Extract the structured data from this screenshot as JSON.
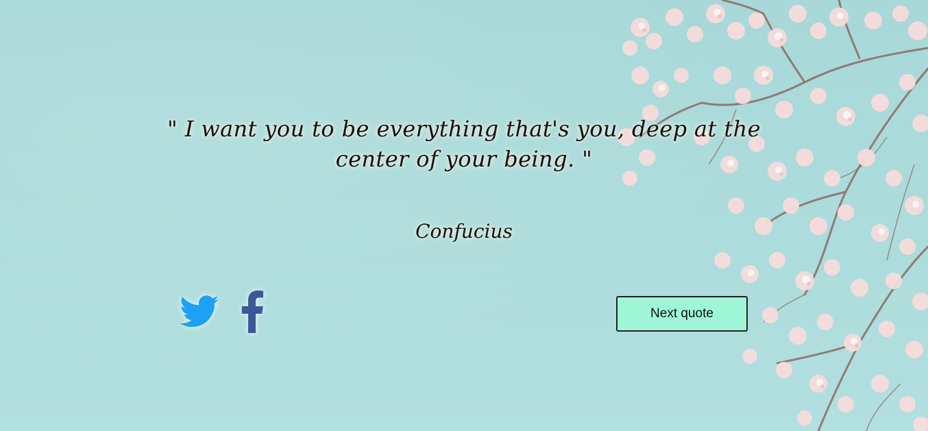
{
  "quote": {
    "text": "\" I want you to be everything that's you, deep at the center of your being. \"",
    "author": "Confucius"
  },
  "social": {
    "twitter_icon": "twitter-icon",
    "facebook_icon": "facebook-icon",
    "twitter_color": "#1da1f2",
    "facebook_color": "#3b5998"
  },
  "actions": {
    "next_label": "Next quote",
    "next_color": "#9ff7d8"
  }
}
